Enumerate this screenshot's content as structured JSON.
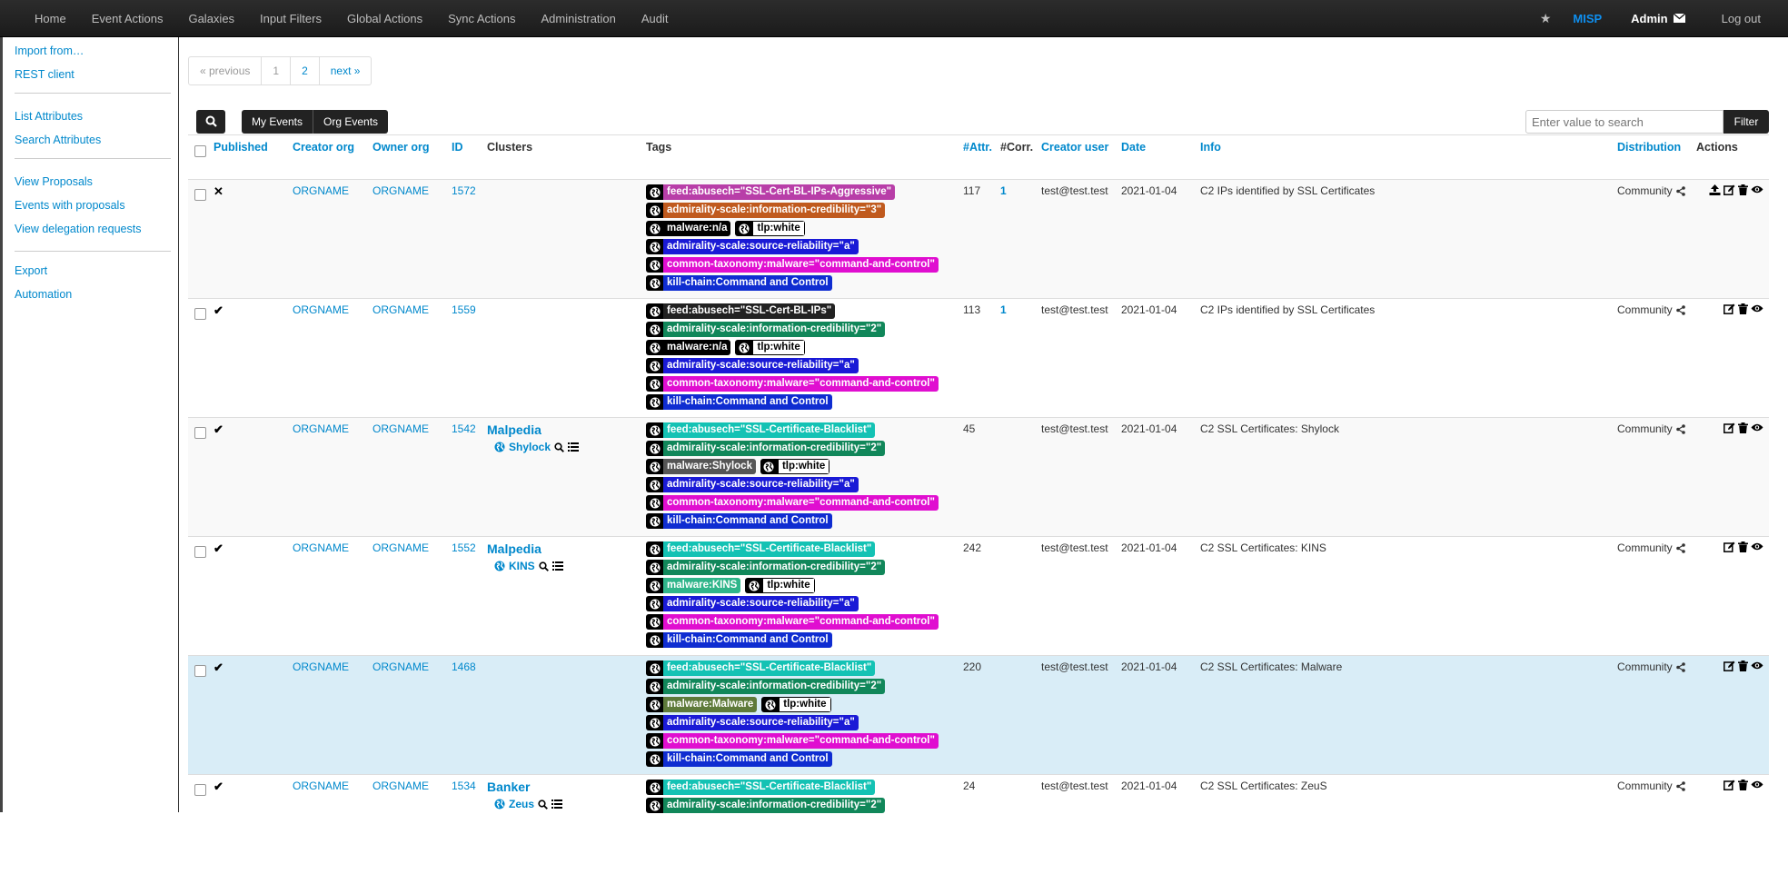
{
  "topnav": {
    "items": [
      "Home",
      "Event Actions",
      "Galaxies",
      "Input Filters",
      "Global Actions",
      "Sync Actions",
      "Administration",
      "Audit"
    ],
    "brand": "MISP",
    "user": "Admin",
    "logout": "Log out"
  },
  "sidebar": {
    "group1": [
      "Import from…",
      "REST client"
    ],
    "group2": [
      "List Attributes",
      "Search Attributes"
    ],
    "group3": [
      "View Proposals",
      "Events with proposals",
      "View delegation requests"
    ],
    "group4": [
      "Export",
      "Automation"
    ]
  },
  "pagination": {
    "prev": "« previous",
    "pages": [
      "1",
      "2"
    ],
    "next": "next »"
  },
  "toolbar": {
    "my_events": "My Events",
    "org_events": "Org Events",
    "search_placeholder": "Enter value to search",
    "filter": "Filter"
  },
  "table": {
    "headers": {
      "published": "Published",
      "creator_org": "Creator org",
      "owner_org": "Owner org",
      "id": "ID",
      "clusters": "Clusters",
      "tags": "Tags",
      "attr": "#Attr.",
      "corr": "#Corr.",
      "creator_user": "Creator user",
      "date": "Date",
      "info": "Info",
      "distribution": "Distribution",
      "actions": "Actions"
    },
    "rows": [
      {
        "published": "✕",
        "creator_org": "ORGNAME",
        "owner_org": "ORGNAME",
        "id": "1572",
        "cluster": "",
        "cluster_sub": "",
        "tags": [
          [
            {
              "text": "feed:abusech=\"SSL-Cert-BL-IPs-Aggressive\"",
              "color": "#b83ea8"
            }
          ],
          [
            {
              "text": "admirality-scale:information-credibility=\"3\"",
              "color": "#c05a1e"
            }
          ],
          [
            {
              "text": "malware:n/a",
              "color": "#000000"
            },
            {
              "text": "tlp:white",
              "color": "#ffffff",
              "light": true
            }
          ],
          [
            {
              "text": "admirality-scale:source-reliability=\"a\"",
              "color": "#1a1ad6"
            }
          ],
          [
            {
              "text": "common-taxonomy:malware=\"command-and-control\"",
              "color": "#e00ed0"
            }
          ],
          [
            {
              "text": "kill-chain:Command and Control",
              "color": "#0f2dd1"
            }
          ]
        ],
        "attr": "117",
        "corr": "1",
        "creator_user": "test@test.test",
        "date": "2021-01-04",
        "info": "C2 IPs identified by SSL Certificates",
        "distribution": "Community",
        "publish_action": true
      },
      {
        "published": "✔",
        "creator_org": "ORGNAME",
        "owner_org": "ORGNAME",
        "id": "1559",
        "cluster": "",
        "cluster_sub": "",
        "tags": [
          [
            {
              "text": "feed:abusech=\"SSL-Cert-BL-IPs\"",
              "color": "#222222"
            }
          ],
          [
            {
              "text": "admirality-scale:information-credibility=\"2\"",
              "color": "#11875a"
            }
          ],
          [
            {
              "text": "malware:n/a",
              "color": "#000000"
            },
            {
              "text": "tlp:white",
              "color": "#ffffff",
              "light": true
            }
          ],
          [
            {
              "text": "admirality-scale:source-reliability=\"a\"",
              "color": "#1a1ad6"
            }
          ],
          [
            {
              "text": "common-taxonomy:malware=\"command-and-control\"",
              "color": "#e00ed0"
            }
          ],
          [
            {
              "text": "kill-chain:Command and Control",
              "color": "#0f2dd1"
            }
          ]
        ],
        "attr": "113",
        "corr": "1",
        "creator_user": "test@test.test",
        "date": "2021-01-04",
        "info": "C2 IPs identified by SSL Certificates",
        "distribution": "Community",
        "publish_action": false
      },
      {
        "published": "✔",
        "creator_org": "ORGNAME",
        "owner_org": "ORGNAME",
        "id": "1542",
        "cluster": "Malpedia",
        "cluster_sub": "Shylock",
        "tags": [
          [
            {
              "text": "feed:abusech=\"SSL-Certificate-Blacklist\"",
              "color": "#14c2b4"
            }
          ],
          [
            {
              "text": "admirality-scale:information-credibility=\"2\"",
              "color": "#11875a"
            }
          ],
          [
            {
              "text": "malware:Shylock",
              "color": "#555555"
            },
            {
              "text": "tlp:white",
              "color": "#ffffff",
              "light": true
            }
          ],
          [
            {
              "text": "admirality-scale:source-reliability=\"a\"",
              "color": "#1a1ad6"
            }
          ],
          [
            {
              "text": "common-taxonomy:malware=\"command-and-control\"",
              "color": "#e00ed0"
            }
          ],
          [
            {
              "text": "kill-chain:Command and Control",
              "color": "#0f2dd1"
            }
          ]
        ],
        "attr": "45",
        "corr": "",
        "creator_user": "test@test.test",
        "date": "2021-01-04",
        "info": "C2 SSL Certificates: Shylock",
        "distribution": "Community",
        "publish_action": false
      },
      {
        "published": "✔",
        "creator_org": "ORGNAME",
        "owner_org": "ORGNAME",
        "id": "1552",
        "cluster": "Malpedia",
        "cluster_sub": "KINS",
        "tags": [
          [
            {
              "text": "feed:abusech=\"SSL-Certificate-Blacklist\"",
              "color": "#14c2b4"
            }
          ],
          [
            {
              "text": "admirality-scale:information-credibility=\"2\"",
              "color": "#11875a"
            }
          ],
          [
            {
              "text": "malware:KINS",
              "color": "#2fb58a"
            },
            {
              "text": "tlp:white",
              "color": "#ffffff",
              "light": true
            }
          ],
          [
            {
              "text": "admirality-scale:source-reliability=\"a\"",
              "color": "#1a1ad6"
            }
          ],
          [
            {
              "text": "common-taxonomy:malware=\"command-and-control\"",
              "color": "#e00ed0"
            }
          ],
          [
            {
              "text": "kill-chain:Command and Control",
              "color": "#0f2dd1"
            }
          ]
        ],
        "attr": "242",
        "corr": "",
        "creator_user": "test@test.test",
        "date": "2021-01-04",
        "info": "C2 SSL Certificates: KINS",
        "distribution": "Community",
        "publish_action": false
      },
      {
        "published": "✔",
        "creator_org": "ORGNAME",
        "owner_org": "ORGNAME",
        "id": "1468",
        "cluster": "",
        "cluster_sub": "",
        "tags": [
          [
            {
              "text": "feed:abusech=\"SSL-Certificate-Blacklist\"",
              "color": "#14c2b4"
            }
          ],
          [
            {
              "text": "admirality-scale:information-credibility=\"2\"",
              "color": "#11875a"
            }
          ],
          [
            {
              "text": "malware:Malware",
              "color": "#5e7a3a"
            },
            {
              "text": "tlp:white",
              "color": "#ffffff",
              "light": true
            }
          ],
          [
            {
              "text": "admirality-scale:source-reliability=\"a\"",
              "color": "#1a1ad6"
            }
          ],
          [
            {
              "text": "common-taxonomy:malware=\"command-and-control\"",
              "color": "#e00ed0"
            }
          ],
          [
            {
              "text": "kill-chain:Command and Control",
              "color": "#0f2dd1"
            }
          ]
        ],
        "attr": "220",
        "corr": "",
        "creator_user": "test@test.test",
        "date": "2021-01-04",
        "info": "C2 SSL Certificates: Malware",
        "distribution": "Community",
        "publish_action": false,
        "highlight": true
      },
      {
        "published": "✔",
        "creator_org": "ORGNAME",
        "owner_org": "ORGNAME",
        "id": "1534",
        "cluster": "Banker",
        "cluster_sub": "Zeus",
        "tags": [
          [
            {
              "text": "feed:abusech=\"SSL-Certificate-Blacklist\"",
              "color": "#14c2b4"
            }
          ],
          [
            {
              "text": "admirality-scale:information-credibility=\"2\"",
              "color": "#11875a"
            }
          ]
        ],
        "attr": "24",
        "corr": "",
        "creator_user": "test@test.test",
        "date": "2021-01-04",
        "info": "C2 SSL Certificates: ZeuS",
        "distribution": "Community",
        "publish_action": false
      }
    ]
  }
}
